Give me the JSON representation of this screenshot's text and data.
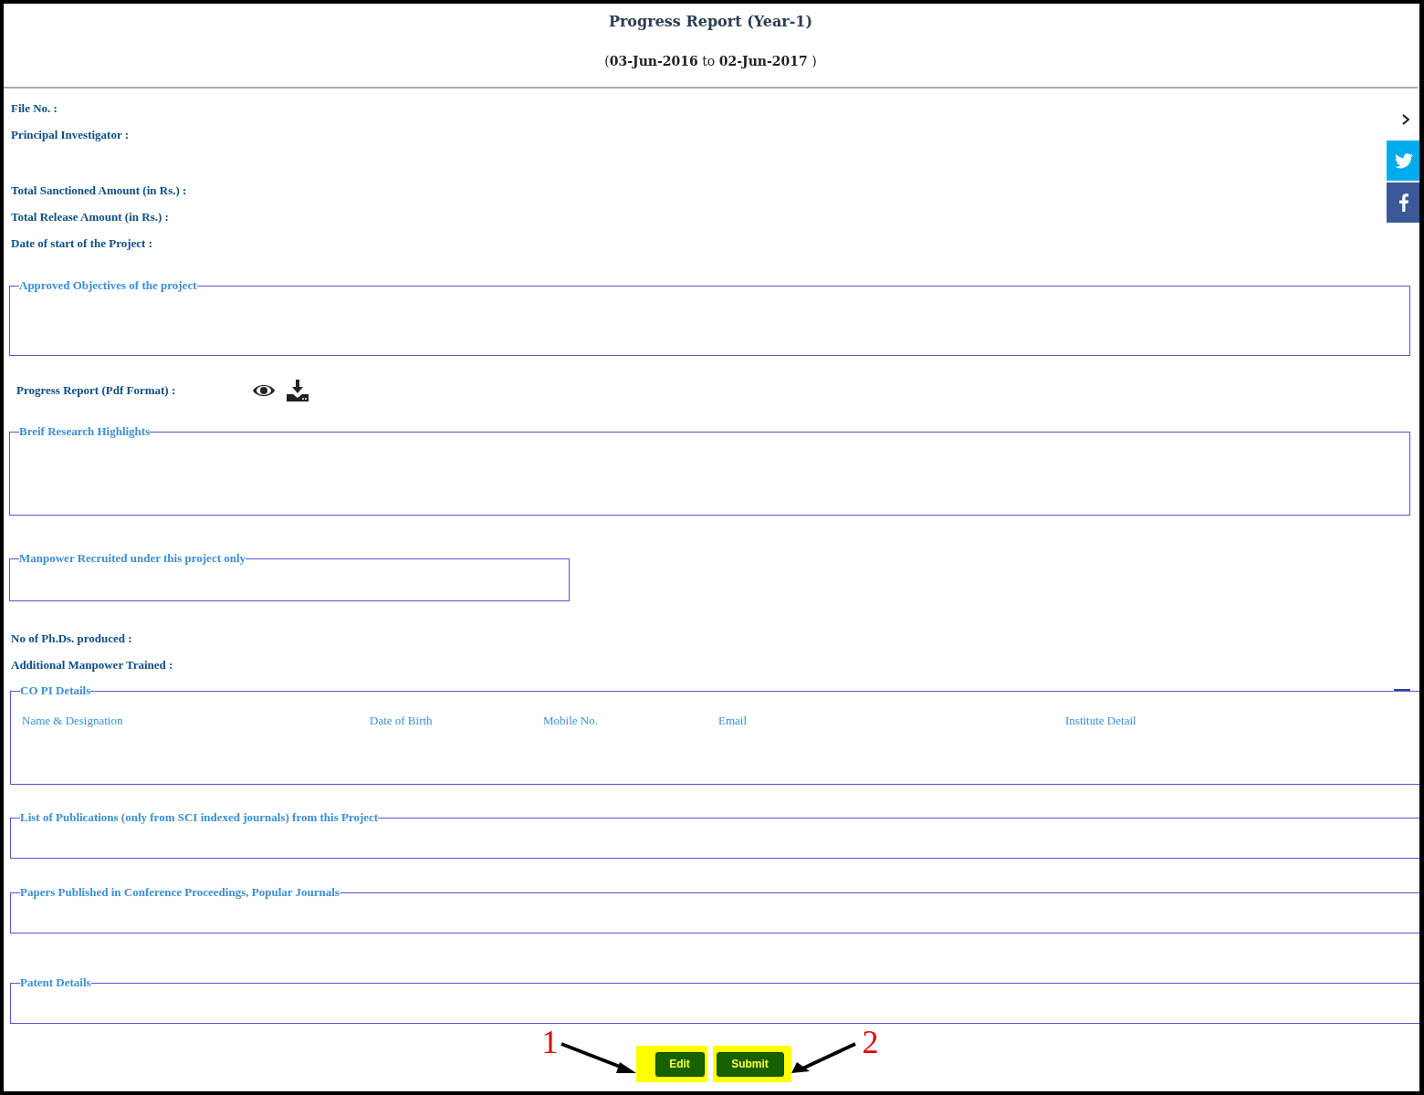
{
  "header": {
    "title": "Progress Report (Year-1)",
    "period": "(**03-Jun-2016** to **02-Jun-2017** )"
  },
  "info_fields": [
    {
      "label": "File No. :"
    },
    {
      "label": "Principal Investigator :"
    }
  ],
  "amount_fields": [
    {
      "label": "Total Sanctioned Amount (in Rs.) :"
    },
    {
      "label": "Total Release Amount (in Rs.) :"
    },
    {
      "label": "Date of start of the Project :"
    }
  ],
  "objectives": {
    "legend": "Approved Objectives of the project"
  },
  "pdf_row": {
    "label": "Progress Report (Pdf Format) :"
  },
  "highlights": {
    "legend": "Breif Research Highlights"
  },
  "manpower": {
    "legend": "Manpower Recruited under this project only"
  },
  "count_fields": [
    {
      "label": "No of Ph.Ds. produced :"
    },
    {
      "label": "Additional Manpower Trained :"
    }
  ],
  "copi": {
    "legend": "CO PI Details",
    "columns": [
      "Name & Designation",
      "Date of Birth",
      "Mobile No.",
      "Email",
      "Institute Detail"
    ]
  },
  "lower_sections": [
    {
      "legend": "List of Publications (only from SCI indexed journals) from this Project"
    },
    {
      "legend": "Papers Published in Conference Proceedings, Popular Journals"
    },
    {
      "legend": "Patent Details"
    }
  ],
  "buttons": [
    {
      "label": "Edit",
      "highlighted": true,
      "marker": "1"
    },
    {
      "label": "Submit",
      "highlighted": true,
      "marker": "2"
    }
  ]
}
